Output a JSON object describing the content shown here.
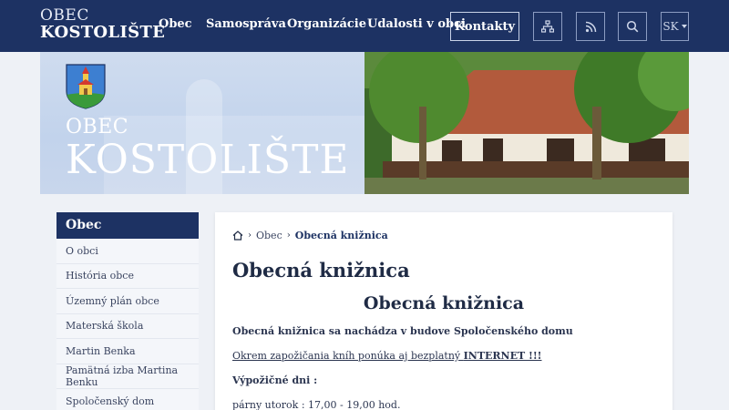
{
  "header": {
    "logo_line1": "OBEC",
    "logo_line2": "KOSTOLIŠTE",
    "nav": [
      "Obec",
      "Samospráva",
      "Organizácie",
      "Udalosti v obci"
    ],
    "contacts_label": "Kontakty",
    "icons": [
      "sitemap-icon",
      "rss-icon",
      "search-icon"
    ],
    "language": "SK"
  },
  "hero": {
    "title_small": "OBEC",
    "title_large": "KOSTOLIŠTE"
  },
  "sidebar": {
    "heading": "Obec",
    "items": [
      {
        "label": "O obci"
      },
      {
        "label": "História obce"
      },
      {
        "label": "Územný plán obce"
      },
      {
        "label": "Materská škola"
      },
      {
        "label": "Martin Benka"
      },
      {
        "label": "Pamätná izba Martina Benku"
      },
      {
        "label": "Spoločenský dom"
      }
    ]
  },
  "breadcrumb": {
    "parent": "Obec",
    "current": "Obecná knižnica"
  },
  "content": {
    "page_title": "Obecná knižnica",
    "center_title": "Obecná knižnica",
    "p1": "Obecná knižnica sa nachádza v budove Spoločenského domu",
    "p2_text": "Okrem zapožičania kníh ponúka aj bezplatný ",
    "p2_bold": "INTERNET !!!",
    "p3": "Výpožičné dni :",
    "p4": "párny utorok : 17,00 - 19,00 hod."
  },
  "colors": {
    "navy": "#1d3263",
    "hero_blue": "#c2d3ec",
    "background": "#eef1f6"
  }
}
